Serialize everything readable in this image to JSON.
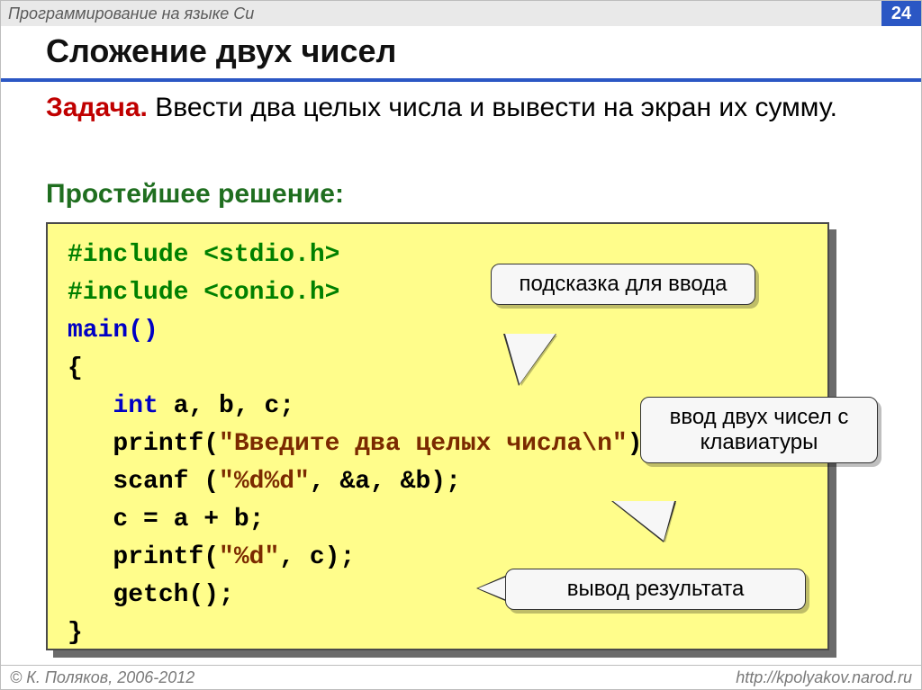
{
  "header": {
    "breadcrumb": "Программирование на языке Си",
    "page_number": "24"
  },
  "title": "Сложение двух чисел",
  "task": {
    "label": "Задача.",
    "text": " Ввести два целых числа и вывести на экран их сумму."
  },
  "solution_label": "Простейшее решение:",
  "code": {
    "l1a": "#include ",
    "l1b": "<stdio.h>",
    "l2a": "#include ",
    "l2b": "<conio.h>",
    "l3": "main()",
    "l4": "{",
    "l5a": "   ",
    "l5b": "int",
    "l5c": " a, b, c;",
    "l6a": "   printf(",
    "l6b": "\"Введите два целых числа\\n\"",
    "l6c": ");",
    "l7a": "   scanf (",
    "l7b": "\"%d%d\"",
    "l7c": ", &a, &b);",
    "l8": "   c = a + b;",
    "l9a": "   printf(",
    "l9b": "\"%d\"",
    "l9c": ", c);",
    "l10": "   getch();",
    "l11": "}"
  },
  "callouts": {
    "c1": "подсказка для ввода",
    "c2": "ввод двух чисел с клавиатуры",
    "c3": "вывод результата"
  },
  "footer": {
    "copyright": "© К. Поляков, 2006-2012",
    "url": "http://kpolyakov.narod.ru"
  }
}
